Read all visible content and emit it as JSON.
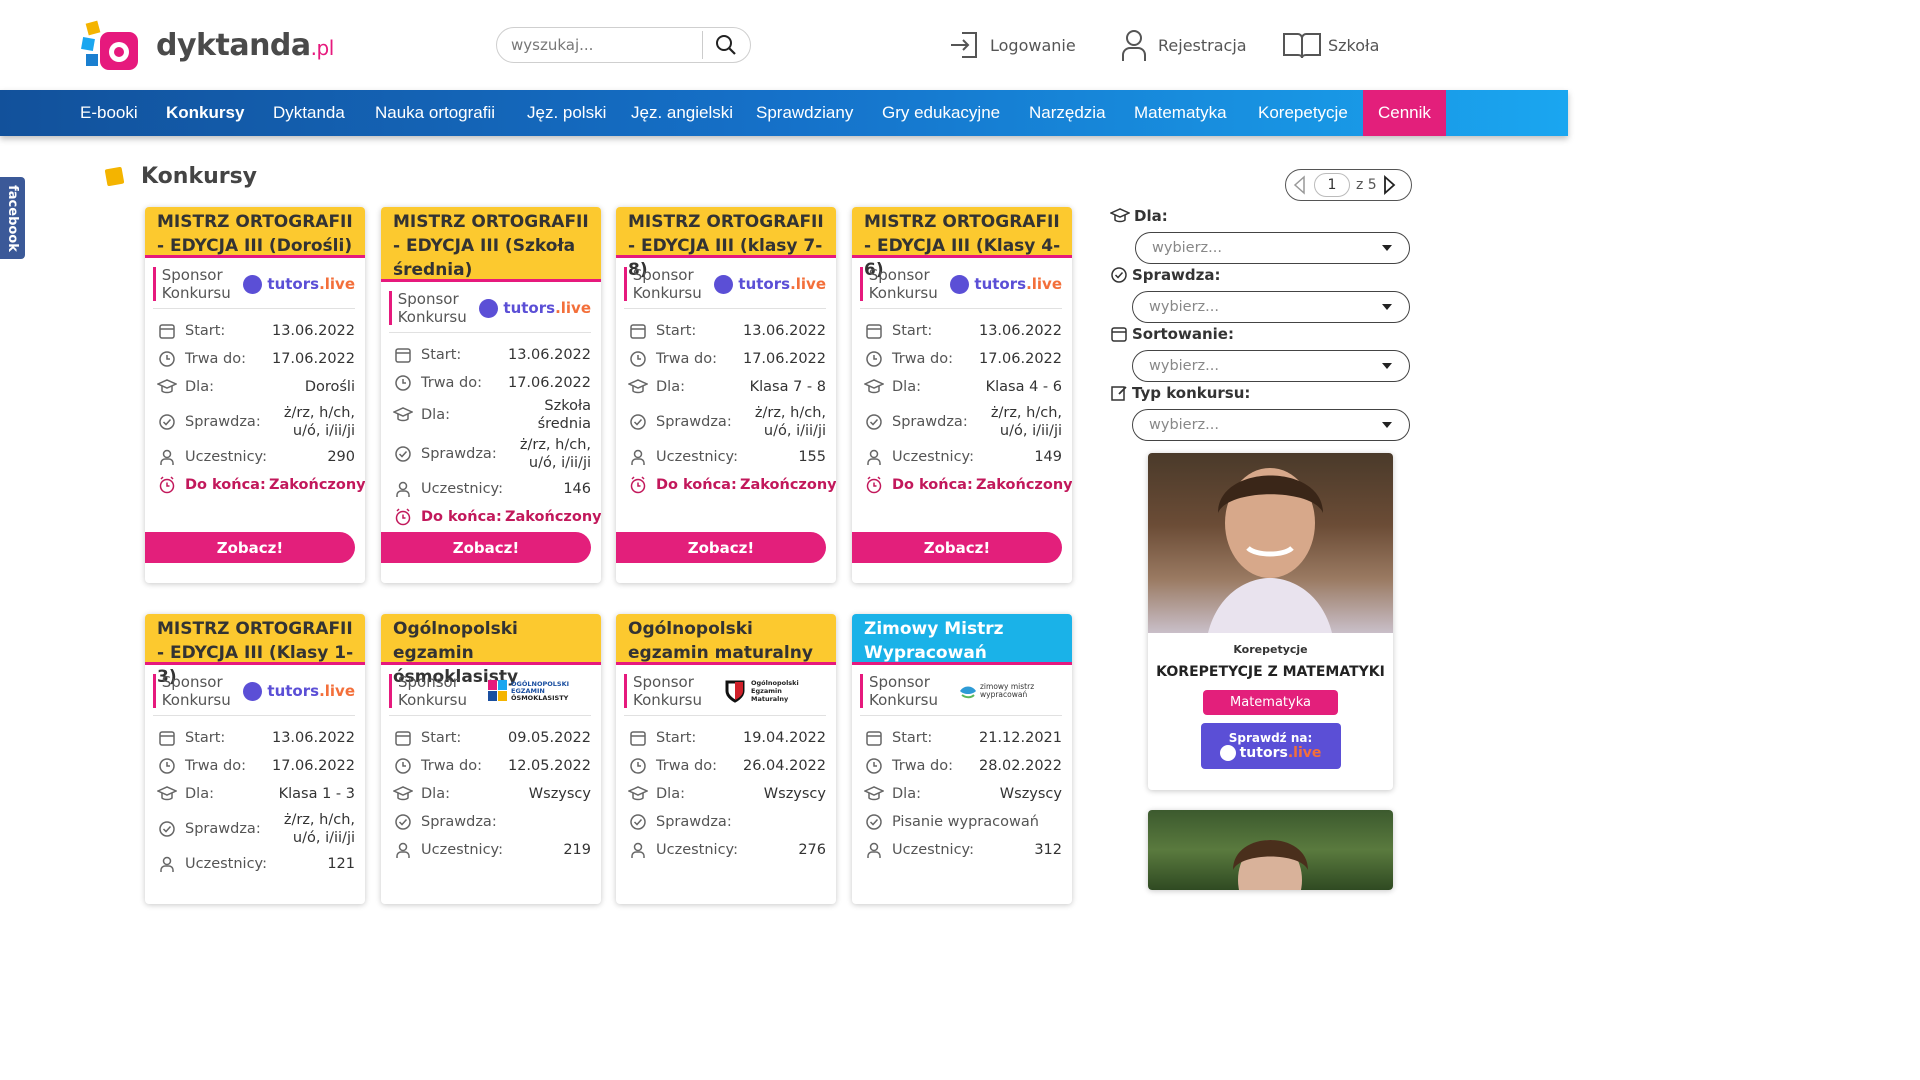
{
  "header": {
    "logo_text": "dyktanda",
    "logo_tld": ".pl",
    "search_placeholder": "wyszukaj...",
    "login": "Logowanie",
    "register": "Rejestracja",
    "school": "Szkoła"
  },
  "nav": [
    "E-booki",
    "Konkursy",
    "Dyktanda",
    "Nauka ortografii",
    "Jęz. polski",
    "Jęz. angielski",
    "Sprawdziany",
    "Gry edukacyjne",
    "Narzędzia",
    "Matematyka",
    "Korepetycje",
    "Cennik"
  ],
  "facebook": "facebook",
  "page_title": "Konkursy",
  "pager": {
    "current": "1",
    "of": "z 5"
  },
  "labels": {
    "sponsor": "Sponsor Konkursu",
    "start": "Start:",
    "until": "Trwa do:",
    "for": "Dla:",
    "checks": "Sprawdza:",
    "participants": "Uczestnicy:",
    "remaining": "Do końca:",
    "see": "Zobacz!"
  },
  "cards": [
    {
      "title": "MISTRZ ORTOGRAFII - EDYCJA III (Dorośli)",
      "sponsor": "tutors.live",
      "start": "13.06.2022",
      "until": "17.06.2022",
      "for": "Dorośli",
      "checks": "ż/rz, h/ch, u/ó, i/ii/ji",
      "participants": "290",
      "remaining": "Zakończony"
    },
    {
      "title": "MISTRZ ORTOGRAFII - EDYCJA III (Szkoła średnia)",
      "sponsor": "tutors.live",
      "start": "13.06.2022",
      "until": "17.06.2022",
      "for": "Szkoła średnia",
      "checks": "ż/rz, h/ch, u/ó, i/ii/ji",
      "participants": "146",
      "remaining": "Zakończony"
    },
    {
      "title": "MISTRZ ORTOGRAFII - EDYCJA III (klasy 7-8)",
      "sponsor": "tutors.live",
      "start": "13.06.2022",
      "until": "17.06.2022",
      "for": "Klasa 7 - 8",
      "checks": "ż/rz, h/ch, u/ó, i/ii/ji",
      "participants": "155",
      "remaining": "Zakończony"
    },
    {
      "title": "MISTRZ ORTOGRAFII - EDYCJA III (Klasy 4-6)",
      "sponsor": "tutors.live",
      "start": "13.06.2022",
      "until": "17.06.2022",
      "for": "Klasa 4 - 6",
      "checks": "ż/rz, h/ch, u/ó, i/ii/ji",
      "participants": "149",
      "remaining": "Zakończony"
    },
    {
      "title": "MISTRZ ORTOGRAFII - EDYCJA III (Klasy 1-3)",
      "sponsor": "tutors.live",
      "start": "13.06.2022",
      "until": "17.06.2022",
      "for": "Klasa 1 - 3",
      "checks": "ż/rz, h/ch, u/ó, i/ii/ji",
      "participants": "121"
    },
    {
      "title": "Ogólnopolski egzamin ósmoklasisty",
      "sponsor_lines": [
        "OGÓLNOPOLSKI",
        "EGZAMIN",
        "ÓSMOKLASISTY"
      ],
      "start": "09.05.2022",
      "until": "12.05.2022",
      "for": "Wszyscy",
      "checks": "",
      "participants": "219"
    },
    {
      "title": "Ogólnopolski egzamin maturalny",
      "sponsor_lines": [
        "Ogólnopolski",
        "Egzamin",
        "Maturalny"
      ],
      "start": "19.04.2022",
      "until": "26.04.2022",
      "for": "Wszyscy",
      "checks": "",
      "participants": "276"
    },
    {
      "title": "Zimowy Mistrz Wypracowań",
      "sponsor_lines": [
        "zimowy mistrz",
        "wypracowań"
      ],
      "start": "21.12.2021",
      "until": "28.02.2022",
      "for": "Wszyscy",
      "checks_line": "Pisanie wypracowań",
      "participants": "312"
    }
  ],
  "filters": {
    "for": "Dla:",
    "checks": "Sprawdza:",
    "sort": "Sortowanie:",
    "type": "Typ konkursu:",
    "placeholder": "wybierz..."
  },
  "promo": {
    "category": "Korepetycje",
    "title": "KOREPETYCJE Z MATEMATYKI",
    "button": "Matematyka",
    "check": "Sprawdź na:",
    "brand1": "tutors",
    "brand2": ".live"
  },
  "colors": {
    "pink": "#e31f7b",
    "yellow": "#fcc92f",
    "blue": "#1ab2e8",
    "nav": "#1571c9",
    "tutors": "#5b4fd6"
  }
}
